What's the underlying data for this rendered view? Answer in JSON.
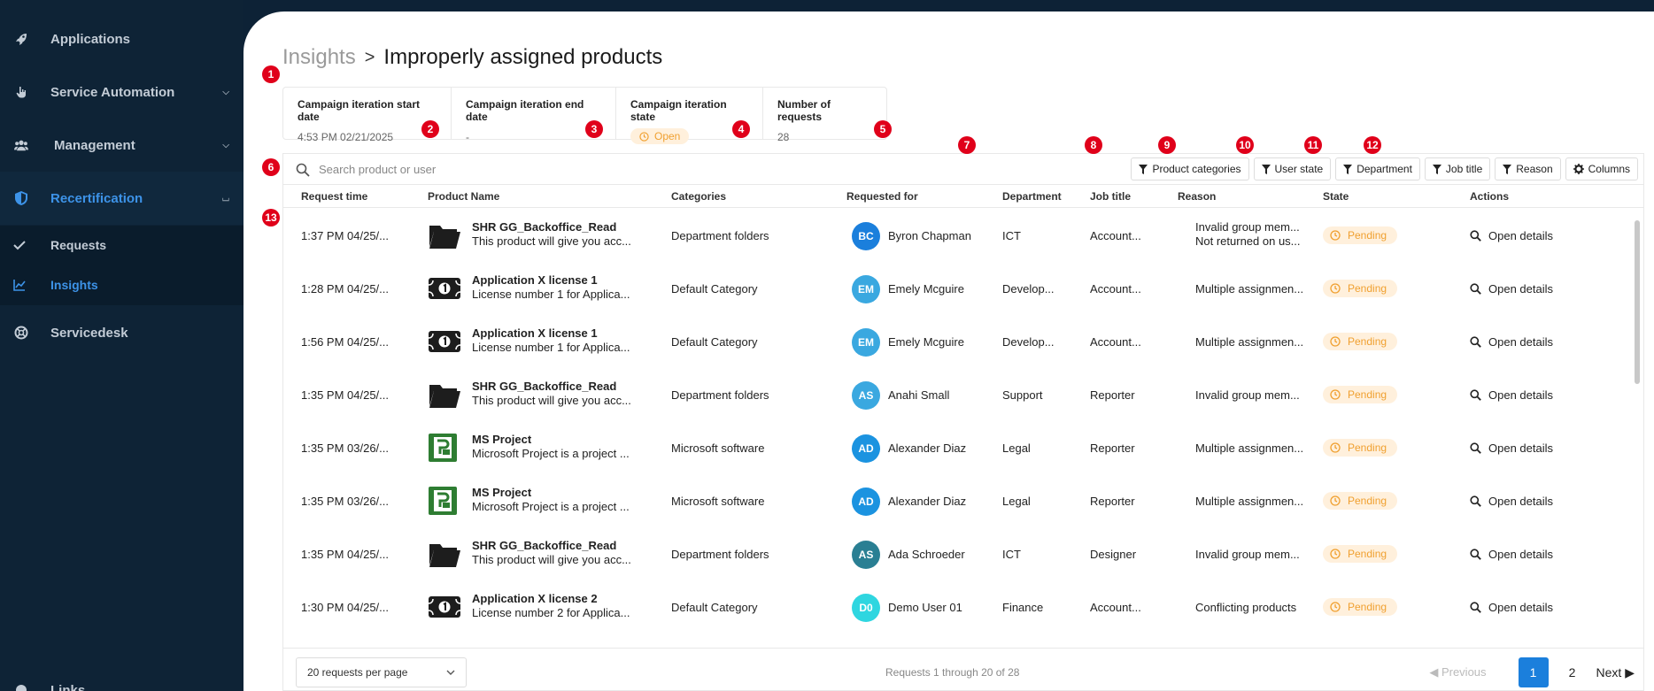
{
  "sidebar": {
    "items": [
      {
        "label": "Applications",
        "icon": "rocket-icon"
      },
      {
        "label": "Service Automation",
        "icon": "hand-icon"
      },
      {
        "label": "Management",
        "icon": "users-icon"
      },
      {
        "label": "Recertification",
        "icon": "shield-icon"
      },
      {
        "label": "Servicedesk",
        "icon": "lifebuoy-icon"
      }
    ],
    "sub_items": [
      {
        "label": "Requests",
        "icon": "check-icon"
      },
      {
        "label": "Insights",
        "icon": "chart-icon"
      }
    ],
    "bottom_cut_label": "Links"
  },
  "breadcrumb": {
    "root": "Insights",
    "separator": ">",
    "title": "Improperly assigned products"
  },
  "stats": [
    {
      "label": "Campaign iteration start date",
      "value": "4:53 PM 02/21/2025"
    },
    {
      "label": "Campaign iteration end date",
      "value": "-"
    },
    {
      "label": "Campaign iteration state",
      "value": "Open"
    },
    {
      "label": "Number of requests",
      "value": "28"
    }
  ],
  "markers": [
    "1",
    "2",
    "3",
    "4",
    "5",
    "6",
    "7",
    "8",
    "9",
    "10",
    "11",
    "12",
    "13"
  ],
  "search": {
    "placeholder": "Search product or user"
  },
  "filters": {
    "product_categories": "Product categories",
    "user_state": "User state",
    "department": "Department",
    "job_title": "Job title",
    "reason": "Reason",
    "columns": "Columns"
  },
  "columns": {
    "request_time": "Request time",
    "product_name": "Product Name",
    "categories": "Categories",
    "requested_for": "Requested for",
    "department": "Department",
    "job_title": "Job title",
    "reason": "Reason",
    "state": "State",
    "actions": "Actions"
  },
  "rows": [
    {
      "time": "1:37 PM 04/25/...",
      "product": "SHR GG_Backoffice_Read",
      "desc": "This product will give you acc...",
      "icon": "folder-icon",
      "category": "Department folders",
      "initials": "BC",
      "avatar_color": "#1b7fdc",
      "user": "Byron Chapman",
      "department": "ICT",
      "job": "Account...",
      "reason": "Invalid group mem...",
      "reason2": "Not returned on us...",
      "state": "Pending",
      "action": "Open details"
    },
    {
      "time": "1:28 PM 04/25/...",
      "product": "Application X license 1",
      "desc": "License number 1 for Applica...",
      "icon": "license-icon",
      "category": "Default Category",
      "initials": "EM",
      "avatar_color": "#3aa8e0",
      "user": "Emely Mcguire",
      "department": "Develop...",
      "job": "Account...",
      "reason": "Multiple assignmen...",
      "reason2": "",
      "state": "Pending",
      "action": "Open details"
    },
    {
      "time": "1:56 PM 04/25/...",
      "product": "Application X license 1",
      "desc": "License number 1 for Applica...",
      "icon": "license-icon",
      "category": "Default Category",
      "initials": "EM",
      "avatar_color": "#3aa8e0",
      "user": "Emely Mcguire",
      "department": "Develop...",
      "job": "Account...",
      "reason": "Multiple assignmen...",
      "reason2": "",
      "state": "Pending",
      "action": "Open details"
    },
    {
      "time": "1:35 PM 04/25/...",
      "product": "SHR GG_Backoffice_Read",
      "desc": "This product will give you acc...",
      "icon": "folder-icon",
      "category": "Department folders",
      "initials": "AS",
      "avatar_color": "#3aa8e0",
      "user": "Anahi Small",
      "department": "Support",
      "job": "Reporter",
      "reason": "Invalid group mem...",
      "reason2": "",
      "state": "Pending",
      "action": "Open details"
    },
    {
      "time": "1:35 PM 03/26/...",
      "product": "MS Project",
      "desc": "Microsoft Project is a project ...",
      "icon": "msproject-icon",
      "category": "Microsoft software",
      "initials": "AD",
      "avatar_color": "#1b93e0",
      "user": "Alexander Diaz",
      "department": "Legal",
      "job": "Reporter",
      "reason": "Multiple assignmen...",
      "reason2": "",
      "state": "Pending",
      "action": "Open details"
    },
    {
      "time": "1:35 PM 03/26/...",
      "product": "MS Project",
      "desc": "Microsoft Project is a project ...",
      "icon": "msproject-icon",
      "category": "Microsoft software",
      "initials": "AD",
      "avatar_color": "#1b93e0",
      "user": "Alexander Diaz",
      "department": "Legal",
      "job": "Reporter",
      "reason": "Multiple assignmen...",
      "reason2": "",
      "state": "Pending",
      "action": "Open details"
    },
    {
      "time": "1:35 PM 04/25/...",
      "product": "SHR GG_Backoffice_Read",
      "desc": "This product will give you acc...",
      "icon": "folder-icon",
      "category": "Department folders",
      "initials": "AS",
      "avatar_color": "#2a7f93",
      "user": "Ada Schroeder",
      "department": "ICT",
      "job": "Designer",
      "reason": "Invalid group mem...",
      "reason2": "",
      "state": "Pending",
      "action": "Open details"
    },
    {
      "time": "1:30 PM 04/25/...",
      "product": "Application X license 2",
      "desc": "License number 2 for Applica...",
      "icon": "license-icon",
      "category": "Default Category",
      "initials": "D0",
      "avatar_color": "#2fd6e0",
      "user": "Demo User 01",
      "department": "Finance",
      "job": "Account...",
      "reason": "Conflicting products",
      "reason2": "",
      "state": "Pending",
      "action": "Open details"
    }
  ],
  "footer": {
    "per_page": "20 requests per page",
    "summary": "Requests 1 through 20 of 28",
    "previous": "Previous",
    "pages": [
      "1",
      "2"
    ],
    "next": "Next"
  },
  "colors": {
    "accent": "#1b7fdc",
    "sidebar": "#0e2336",
    "pending_bg": "#fff0dc",
    "pending_text": "#f0a030",
    "marker": "#e0001a"
  }
}
